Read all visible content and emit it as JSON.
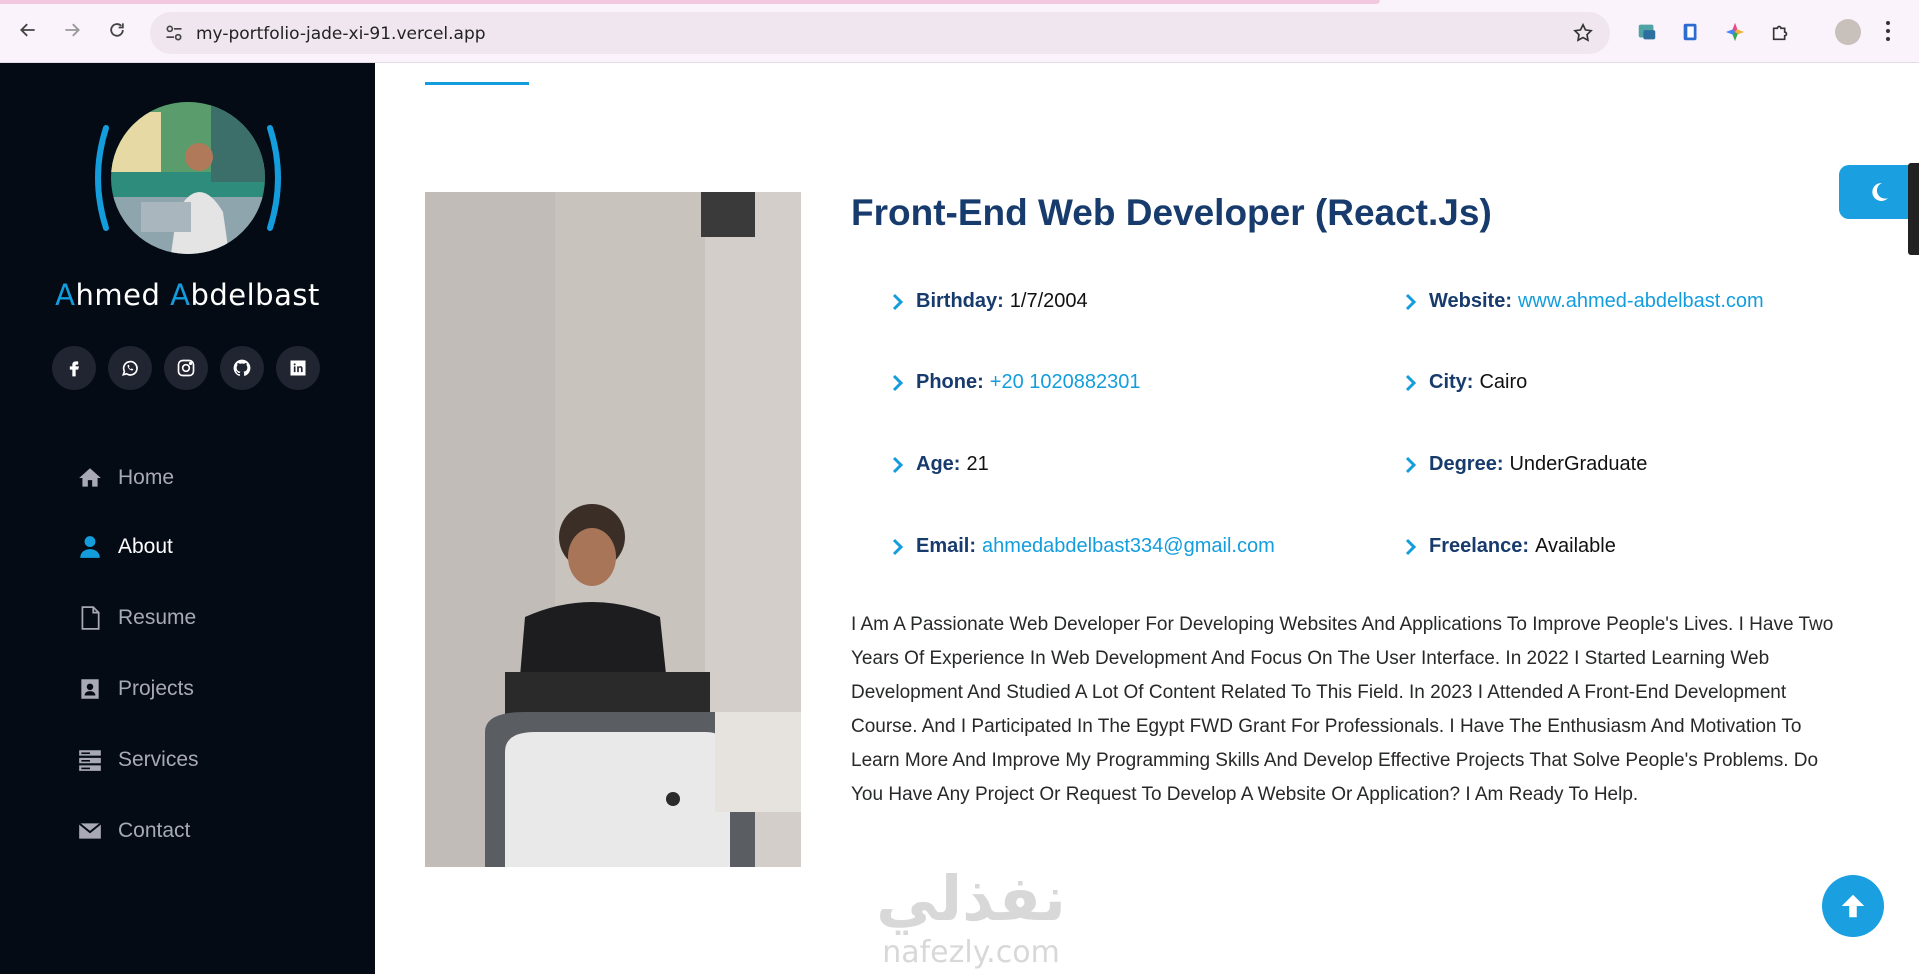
{
  "browser": {
    "url": "my-portfolio-jade-xi-91.vercel.app",
    "icons": [
      "back-icon",
      "forward-icon",
      "reload-icon",
      "site-settings-icon",
      "star-icon",
      "extension-icon",
      "puzzle-icon",
      "profile-icon",
      "menu-icon"
    ]
  },
  "sidebar": {
    "name_first_initial": "A",
    "name_first_rest": "hmed ",
    "name_last_initial": "A",
    "name_last_rest": "bdelbast",
    "socials": [
      "facebook-icon",
      "whatsapp-icon",
      "instagram-icon",
      "github-icon",
      "linkedin-icon"
    ],
    "menu": [
      {
        "label": "Home",
        "icon": "home-icon"
      },
      {
        "label": "About",
        "icon": "user-icon",
        "active": true
      },
      {
        "label": "Resume",
        "icon": "file-icon"
      },
      {
        "label": "Projects",
        "icon": "portfolio-icon"
      },
      {
        "label": "Services",
        "icon": "server-icon"
      },
      {
        "label": "Contact",
        "icon": "envelope-icon"
      }
    ]
  },
  "about": {
    "title": "Front-End Web Developer (React.Js)",
    "info": {
      "birthday": {
        "label": "Birthday:",
        "value": "1/7/2004"
      },
      "website": {
        "label": "Website:",
        "value": "www.ahmed-abdelbast.com"
      },
      "phone": {
        "label": "Phone:",
        "value": "+20 1020882301"
      },
      "city": {
        "label": "City:",
        "value": "Cairo"
      },
      "age": {
        "label": "Age:",
        "value": "21"
      },
      "degree": {
        "label": "Degree:",
        "value": "UnderGraduate"
      },
      "email": {
        "label": "Email:",
        "value": "ahmedabdelbast334@gmail.com"
      },
      "freelance": {
        "label": "Freelance:",
        "value": "Available"
      }
    },
    "bio": "I Am A Passionate Web Developer For Developing Websites And Applications To Improve People's Lives. I Have Two Years Of Experience In Web Development And Focus On The User Interface. In 2022 I Started Learning Web Development And Studied A Lot Of Content Related To This Field. In 2023 I Attended A Front-End Development Course. And I Participated In The Egypt FWD Grant For Professionals. I Have The Enthusiasm And Motivation To Learn More And Improve My Programming Skills And Develop Effective Projects That Solve People's Problems. Do You Have Any Project Or Request To Develop A Website Or Application? I Am Ready To Help."
  },
  "watermark": {
    "arabic": "نفذلي",
    "latin": "nafezly.com"
  },
  "colors": {
    "accent": "#149ddd",
    "heading": "#173b6c",
    "sidebar_bg": "#040b14"
  }
}
